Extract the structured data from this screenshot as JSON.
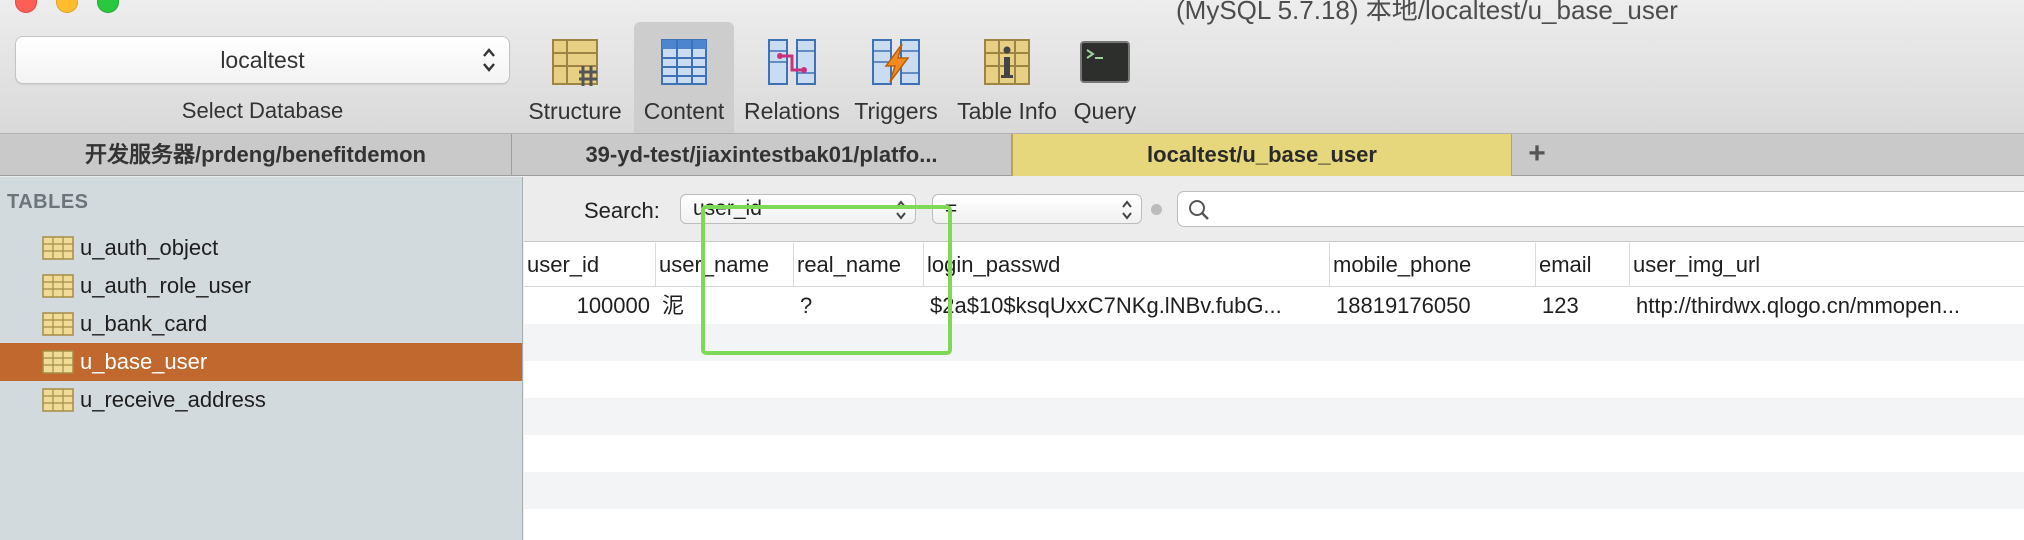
{
  "window": {
    "title": "(MySQL 5.7.18) 本地/localtest/u_base_user"
  },
  "toolbar": {
    "database": {
      "value": "localtest",
      "label": "Select Database"
    },
    "buttons": [
      {
        "label": "Structure",
        "icon": "structure-icon",
        "active": false
      },
      {
        "label": "Content",
        "icon": "content-icon",
        "active": true
      },
      {
        "label": "Relations",
        "icon": "relations-icon",
        "active": false
      },
      {
        "label": "Triggers",
        "icon": "triggers-icon",
        "active": false
      },
      {
        "label": "Table Info",
        "icon": "table-info-icon",
        "active": false
      },
      {
        "label": "Query",
        "icon": "query-icon",
        "active": false
      }
    ]
  },
  "tabs": [
    {
      "label": "开发服务器/prdeng/benefitdemon",
      "active": false
    },
    {
      "label": "39-yd-test/jiaxintestbak01/platfo...",
      "active": false
    },
    {
      "label": "localtest/u_base_user",
      "active": true
    }
  ],
  "tab_add_label": "+",
  "sidebar": {
    "heading": "TABLES",
    "tables": [
      {
        "name": "u_auth_object",
        "selected": false
      },
      {
        "name": "u_auth_role_user",
        "selected": false
      },
      {
        "name": "u_bank_card",
        "selected": false
      },
      {
        "name": "u_base_user",
        "selected": true
      },
      {
        "name": "u_receive_address",
        "selected": false
      }
    ]
  },
  "filter": {
    "label": "Search:",
    "field": "user_id",
    "operator": "=",
    "value": ""
  },
  "grid": {
    "columns": [
      "user_id",
      "user_name",
      "real_name",
      "login_passwd",
      "mobile_phone",
      "email",
      "user_img_url"
    ],
    "rows": [
      [
        "100000",
        "泥",
        "?",
        "$2a$10$ksqUxxC7NKg.lNBv.fubG...",
        "18819176050",
        "123",
        "http://thirdwx.qlogo.cn/mmopen..."
      ]
    ]
  },
  "colors": {
    "selected_row": "#c0682d",
    "active_tab": "#e6d67c",
    "highlight": "#7ed957",
    "sidebar_bg": "#d3dade"
  }
}
